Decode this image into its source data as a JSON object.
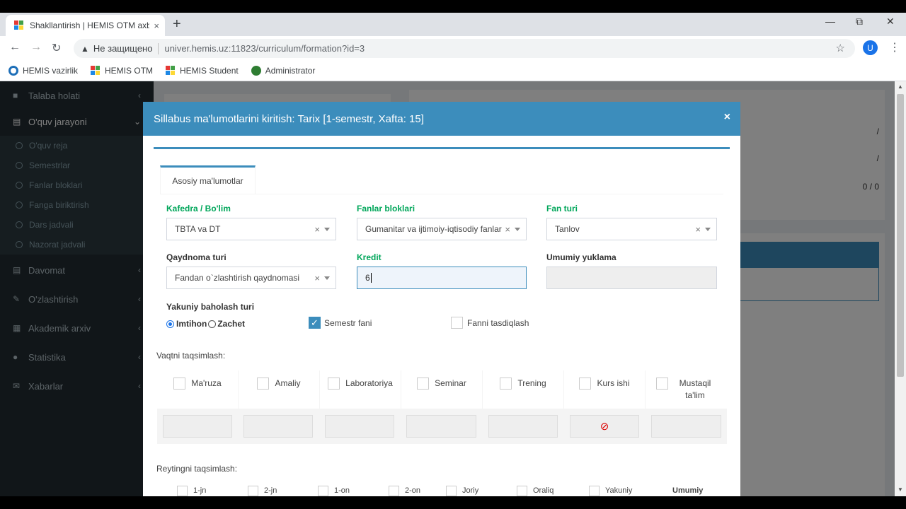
{
  "browser": {
    "tab_title": "Shakllantirish | HEMIS OTM axbo",
    "tab_close": "×",
    "new_tab": "+",
    "security_label": "Не защищено",
    "url": "univer.hemis.uz:11823/curriculum/formation?id=3",
    "avatar_letter": "U",
    "bookmarks": [
      "HEMIS vazirlik",
      "HEMIS OTM",
      "HEMIS Student",
      "Administrator"
    ]
  },
  "sidebar": {
    "top_item": "Talaba holati",
    "section": "O'quv jarayoni",
    "sub_items": [
      "O'quv reja",
      "Semestrlar",
      "Fanlar bloklari",
      "Fanga biriktirish",
      "Dars jadvali",
      "Nazorat jadvali"
    ],
    "items": [
      "Davomat",
      "O'zlashtirish",
      "Akademik arxiv",
      "Statistika",
      "Xabarlar"
    ]
  },
  "background": {
    "slash1": "/",
    "slash2": "/",
    "ratio": "0 / 0"
  },
  "modal": {
    "title": "Sillabus ma'lumotlarini kiritish: Tarix [1-semestr, Xafta: 15]",
    "close": "×",
    "tab": "Asosiy ma'lumotlar",
    "fields": {
      "kafedra_label": "Kafedra / Bo'lim",
      "kafedra_value": "TBTA va DT",
      "fanlar_label": "Fanlar bloklari",
      "fanlar_value": "Gumanitar va ijtimoiy-iqtisodiy fanlar",
      "fan_turi_label": "Fan turi",
      "fan_turi_value": "Tanlov",
      "qaydnoma_label": "Qaydnoma turi",
      "qaydnoma_value": "Fandan o`zlashtirish qaydnomasi",
      "kredit_label": "Kredit",
      "kredit_value": "6",
      "umumiy_label": "Umumiy yuklama",
      "yakuniy_label": "Yakuniy baholash turi",
      "imtihon": "Imtihon",
      "zachet": "Zachet",
      "semestr_fani": "Semestr fani",
      "fanni_tasdiqlash": "Fanni tasdiqlash",
      "clear": "×"
    },
    "vaqt_label": "Vaqtni taqsimlash:",
    "vaqt_columns": [
      "Ma'ruza",
      "Amaliy",
      "Laboratoriya",
      "Seminar",
      "Trening",
      "Kurs ishi",
      "Mustaqil ta'lim"
    ],
    "reyting_label": "Reytingni taqsimlash:",
    "reyting_columns": [
      "1-jn",
      "2-jn",
      "1-on",
      "2-on",
      "Joriy",
      "Oraliq",
      "Yakuniy",
      "Umumiy"
    ]
  }
}
